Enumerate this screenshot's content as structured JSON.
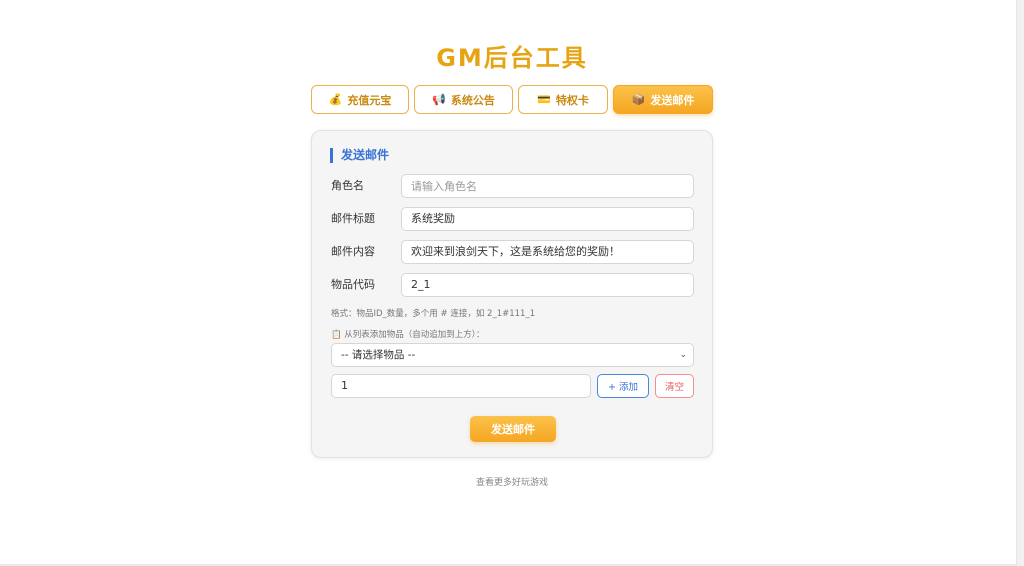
{
  "page": {
    "title": "GM后台工具"
  },
  "tabs": [
    {
      "icon": "money-bag-icon",
      "glyph": "💰",
      "label": "充值元宝"
    },
    {
      "icon": "megaphone-icon",
      "glyph": "📢",
      "label": "系统公告"
    },
    {
      "icon": "card-icon",
      "glyph": "💳",
      "label": "特权卡"
    },
    {
      "icon": "package-icon",
      "glyph": "📦",
      "label": "发送邮件",
      "active": true
    }
  ],
  "form": {
    "section_title": "发送邮件",
    "role_name": {
      "label": "角色名",
      "value": "",
      "placeholder": "请输入角色名"
    },
    "mail_title": {
      "label": "邮件标题",
      "value": "系统奖励"
    },
    "mail_content": {
      "label": "邮件内容",
      "value": "欢迎来到浪剑天下，这是系统给您的奖励！"
    },
    "item_code": {
      "label": "物品代码",
      "value": "2_1"
    },
    "format_hint": "格式：物品ID_数量，多个用 # 连接，如 2_1#111_1",
    "item_list_label": "📋 从列表添加物品（自动追加到上方）：",
    "item_select": {
      "selected": "-- 请选择物品 --"
    },
    "quantity": {
      "value": "1"
    },
    "add_button": "+ 添加",
    "clear_button": "清空",
    "send_button": "发送邮件"
  },
  "footer": {
    "link": "查看更多好玩游戏"
  },
  "colors": {
    "accent": "#f5a623",
    "title": "#e6a414",
    "section": "#3a73d6",
    "danger": "#e55d5d"
  }
}
